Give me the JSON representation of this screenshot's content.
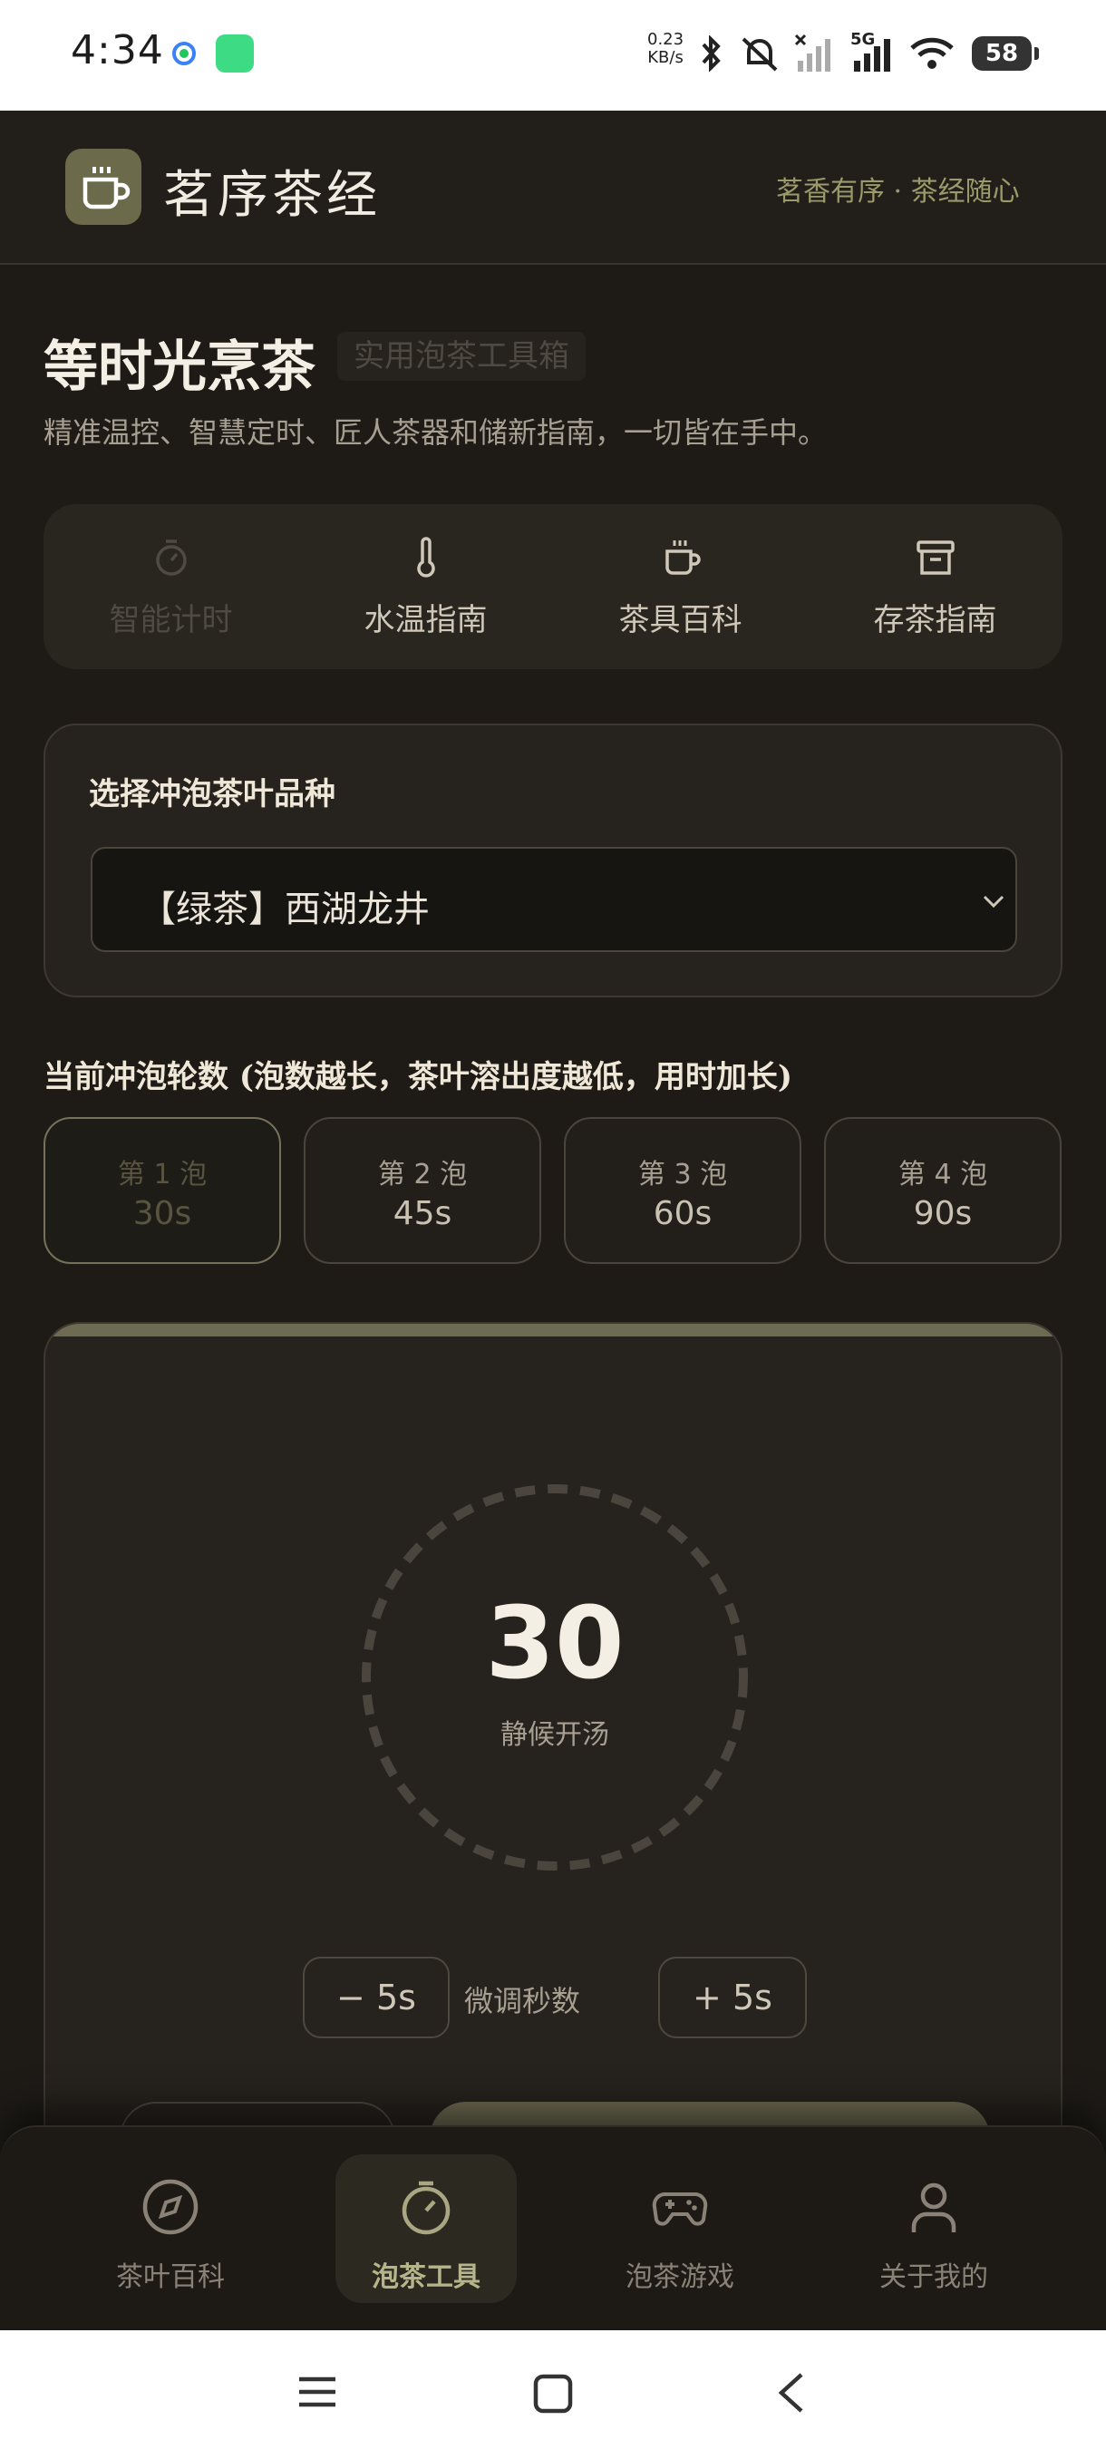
{
  "status_bar": {
    "time": "4:34",
    "net_speed_value": "0.23",
    "net_speed_unit": "KB/s",
    "network": "5G",
    "battery": "58"
  },
  "header": {
    "brand": "茗序茶经",
    "slogan": "茗香有序 · 茶经随心",
    "logo_icon": "tea-cup-icon"
  },
  "intro": {
    "title": "等时光烹茶",
    "tag": "实用泡茶工具箱",
    "description": "精准温控、智慧定时、匠人茶器和储新指南，一切皆在手中。"
  },
  "tool_tabs": [
    {
      "label": "智能计时",
      "icon": "timer-icon",
      "active": true
    },
    {
      "label": "水温指南",
      "icon": "thermometer-icon",
      "active": false
    },
    {
      "label": "茶具百科",
      "icon": "tea-cup-icon",
      "active": false
    },
    {
      "label": "存茶指南",
      "icon": "archive-icon",
      "active": false
    }
  ],
  "selection": {
    "label": "选择冲泡茶叶品种",
    "selected": "【绿茶】西湖龙井"
  },
  "rounds": {
    "label": "当前冲泡轮数 (泡数越长，茶叶溶出度越低，用时加长)",
    "items": [
      {
        "title": "第 1 泡",
        "time": "30s",
        "active": true
      },
      {
        "title": "第 2 泡",
        "time": "45s",
        "active": false
      },
      {
        "title": "第 3 泡",
        "time": "60s",
        "active": false
      },
      {
        "title": "第 4 泡",
        "time": "90s",
        "active": false
      }
    ]
  },
  "timer": {
    "count": "30",
    "status": "静候开汤",
    "minus_label": "− 5s",
    "adjust_label": "微调秒数",
    "plus_label": "+ 5s"
  },
  "bottom_nav": [
    {
      "label": "茶叶百科",
      "icon": "compass-icon",
      "active": false
    },
    {
      "label": "泡茶工具",
      "icon": "timer-icon",
      "active": true
    },
    {
      "label": "泡茶游戏",
      "icon": "gamepad-icon",
      "active": false
    },
    {
      "label": "关于我的",
      "icon": "user-icon",
      "active": false
    }
  ],
  "colors": {
    "background": "#1e1b17",
    "accent": "#6e6b52",
    "text": "#e8e2d6"
  }
}
